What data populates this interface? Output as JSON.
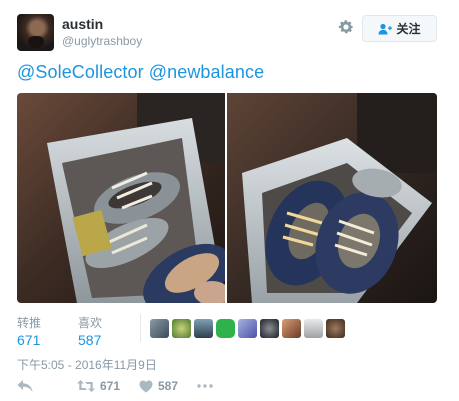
{
  "user": {
    "name": "austin",
    "handle": "@uglytrashboy"
  },
  "header": {
    "settings_icon": "gear-icon",
    "follow_label": "关注",
    "follow_icon": "follow-user-icon"
  },
  "tweet": {
    "mentions": [
      "@SoleCollector",
      "@newbalance"
    ],
    "photos": [
      {
        "content": "photo of worn grey and blue sneakers in a trash bin"
      },
      {
        "content": "photo of worn navy and grey sneakers in a trash bin"
      }
    ],
    "timestamp": "下午5:05 - 2016年11月9日"
  },
  "stats": {
    "retweets_label": "转推",
    "retweets_count": "671",
    "likes_label": "喜欢",
    "likes_count": "587",
    "liker_count": 9
  },
  "actions": {
    "reply_icon": "reply-icon",
    "retweet_icon": "retweet-icon",
    "retweet_count": "671",
    "like_icon": "heart-icon",
    "like_count": "587",
    "more_icon": "more-dots-icon"
  },
  "colors": {
    "link": "#1b95e0",
    "muted": "#8899a6",
    "border": "#e1e8ed"
  }
}
